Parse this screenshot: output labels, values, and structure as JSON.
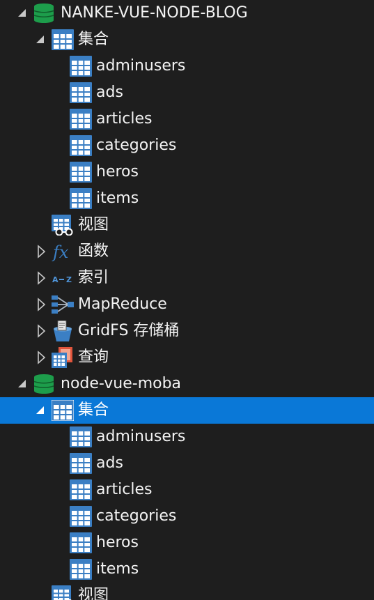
{
  "databases": [
    {
      "name": "NANKE-VUE-NODE-BLOG",
      "expanded": true,
      "collection_folder": {
        "label": "集合",
        "expanded": true,
        "items": [
          "adminusers",
          "ads",
          "articles",
          "categories",
          "heros",
          "items"
        ]
      },
      "folders": [
        {
          "label": "视图",
          "icon": "view-icon",
          "has_expander": false
        },
        {
          "label": "函数",
          "icon": "function-icon",
          "has_expander": true
        },
        {
          "label": "索引",
          "icon": "index-icon",
          "has_expander": true
        },
        {
          "label": "MapReduce",
          "icon": "mapreduce-icon",
          "has_expander": true
        },
        {
          "label": "GridFS 存储桶",
          "icon": "gridfs-bucket-icon",
          "has_expander": true
        },
        {
          "label": "查询",
          "icon": "query-icon",
          "has_expander": true
        }
      ]
    },
    {
      "name": "node-vue-moba",
      "expanded": true,
      "collection_folder": {
        "label": "集合",
        "expanded": true,
        "selected": true,
        "items": [
          "adminusers",
          "ads",
          "articles",
          "categories",
          "heros",
          "items"
        ]
      },
      "folders": [
        {
          "label": "视图",
          "icon": "view-icon",
          "has_expander": false
        }
      ]
    }
  ],
  "colors": {
    "background": "#1e1e1e",
    "selection": "#0a78d7",
    "text": "#f3f3f3",
    "database_green": "#1d9d4b",
    "table_blue": "#3b7fc4",
    "arrow": "#c8c8c8"
  }
}
